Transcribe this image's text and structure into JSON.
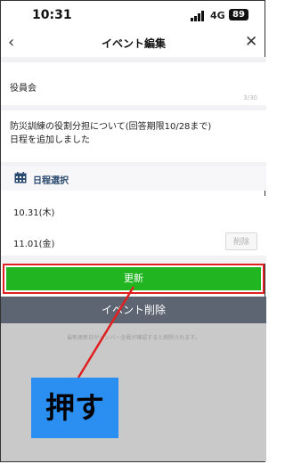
{
  "status_bar": {
    "time": "10:31",
    "network": "4G",
    "battery": "89"
  },
  "header": {
    "back_icon": "chevron-left-icon",
    "title": "イベント編集",
    "close_icon": "close-icon"
  },
  "title_field": {
    "value": "役員会",
    "counter": "3/30"
  },
  "description_field": {
    "line1": "防災訓練の役割分担について(回答期限10/28まで)",
    "line2": "日程を追加しました"
  },
  "schedule": {
    "icon": "calendar-icon",
    "label": "日程選択",
    "dates": [
      {
        "label": "10.31(木)"
      },
      {
        "label": "11.01(金)",
        "delete_label": "削除"
      }
    ]
  },
  "update_button": {
    "label": "更新"
  },
  "delete_event_button": {
    "label": "イベント削除"
  },
  "notice": "最新更新日がメンバー全員が確認すると削除されます。",
  "annotation": {
    "label": "押す"
  },
  "colors": {
    "update": "#22b522",
    "highlight": "#e02020",
    "annotation_box": "#2a8ff0",
    "delete_bar": "#5d6572"
  }
}
